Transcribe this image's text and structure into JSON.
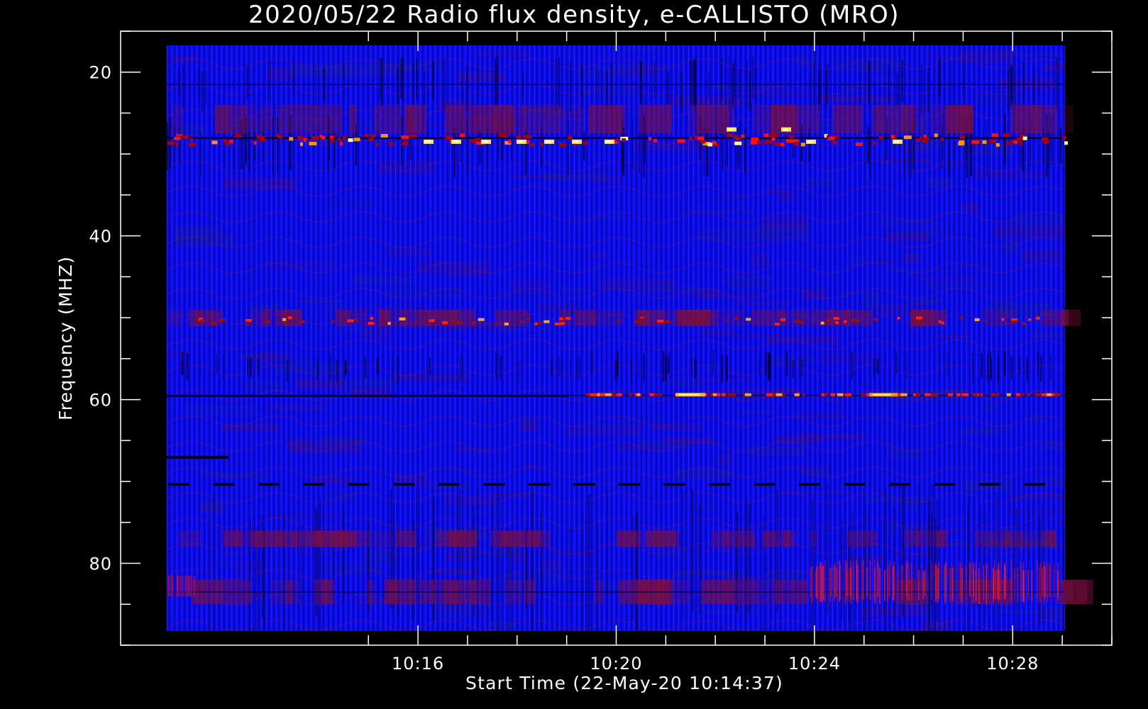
{
  "chart_data": {
    "type": "heatmap",
    "title": "2020/05/22  Radio flux density, e-CALLISTO (MRO)",
    "xlabel": "Start Time (22-May-20 10:14:37)",
    "ylabel": "Frequency (MHZ)",
    "x_start": "10:15",
    "x_end": "10:30",
    "xlim_minutes": [
      10.0,
      30.0
    ],
    "ylim": [
      90,
      15
    ],
    "y_range": [
      16,
      90
    ],
    "x_ticks": [
      "10:16",
      "10:20",
      "10:24",
      "10:28"
    ],
    "x_tick_values_minutes": [
      16,
      20,
      24,
      28
    ],
    "y_ticks": [
      "20",
      "40",
      "60",
      "80"
    ],
    "y_tick_values": [
      20,
      40,
      60,
      80
    ],
    "colormap": [
      "#0000ff",
      "#2020c8",
      "#800000",
      "#ff0000",
      "#ff8000",
      "#ffff80"
    ],
    "bright_bands_mhz": [
      28,
      50,
      59.5,
      70
    ],
    "dark_lines_mhz": [
      28,
      59.5,
      67,
      70
    ],
    "grid": false
  },
  "colors": {
    "background": "#000000",
    "axes": "#ffffff",
    "text": "#ffffff"
  }
}
